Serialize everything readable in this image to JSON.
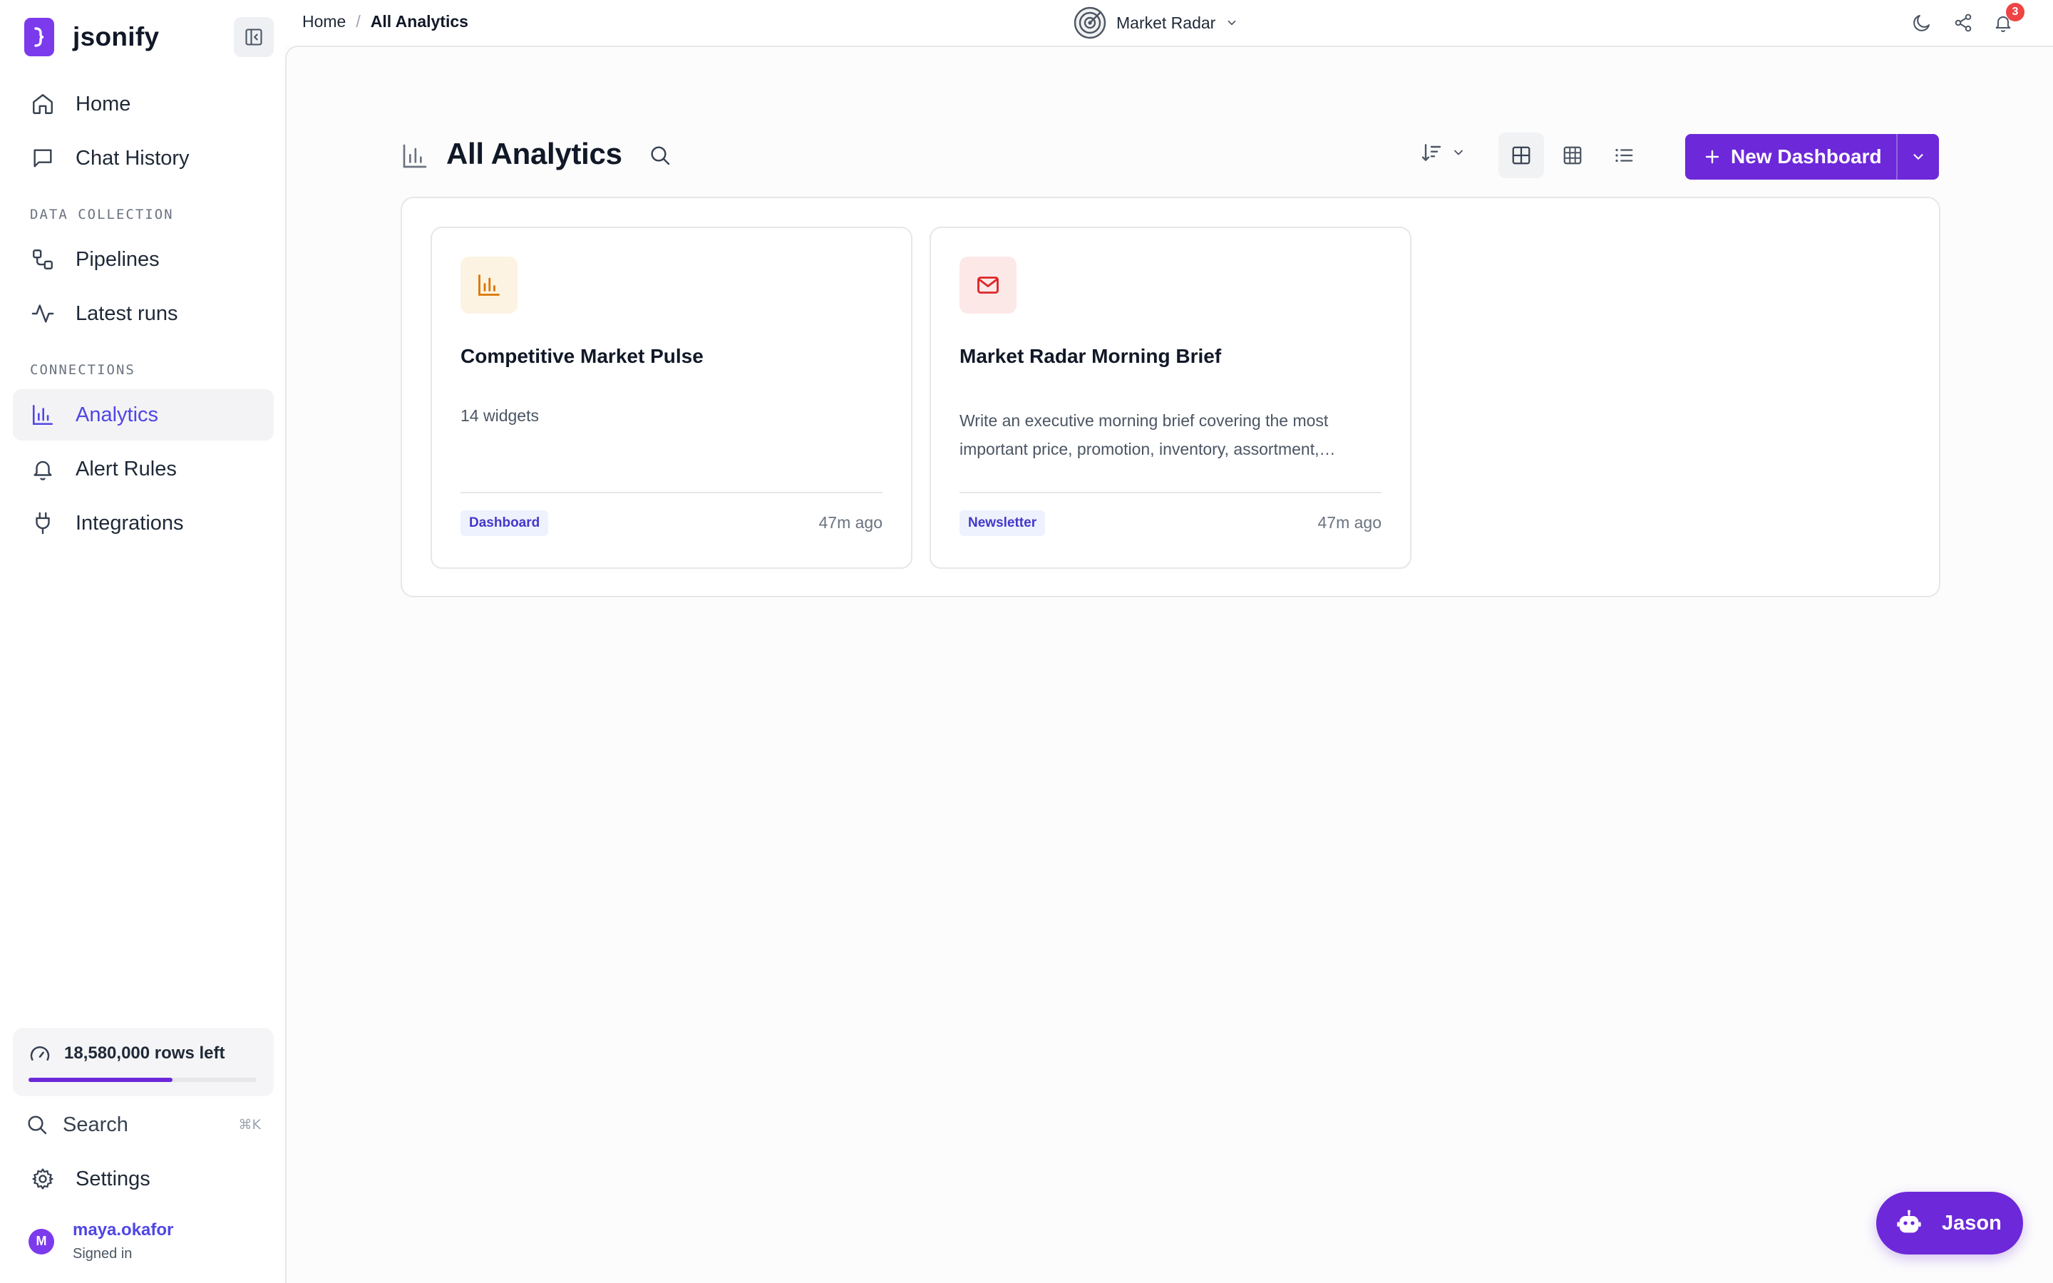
{
  "app": {
    "name": "jsonify"
  },
  "sidebar": {
    "nav": [
      {
        "label": "Home",
        "icon": "home-icon"
      },
      {
        "label": "Chat History",
        "icon": "chat-icon"
      }
    ],
    "section_data_collection": "DATA COLLECTION",
    "data_collection": [
      {
        "label": "Pipelines",
        "icon": "pipeline-icon"
      },
      {
        "label": "Latest runs",
        "icon": "activity-icon"
      }
    ],
    "section_connections": "CONNECTIONS",
    "connections": [
      {
        "label": "Analytics",
        "icon": "bar-chart-icon",
        "active": true
      },
      {
        "label": "Alert Rules",
        "icon": "bell-icon"
      },
      {
        "label": "Integrations",
        "icon": "plug-icon"
      }
    ],
    "usage": {
      "text": "18,580,000 rows left",
      "fraction": 0.63
    },
    "search": {
      "label": "Search",
      "shortcut": "⌘K"
    },
    "settings": {
      "label": "Settings"
    },
    "user": {
      "initial": "M",
      "name": "maya.okafor",
      "status": "Signed in"
    }
  },
  "topbar": {
    "breadcrumb": {
      "home": "Home",
      "separator": "/",
      "current": "All Analytics"
    },
    "workspace": {
      "name": "Market Radar",
      "icon": "radar-icon"
    },
    "notifications_count": "3"
  },
  "page": {
    "title": "All Analytics",
    "new_button": {
      "label": "New Dashboard"
    },
    "cards": [
      {
        "title": "Competitive Market Pulse",
        "meta": "14 widgets",
        "tag": "Dashboard",
        "time": "47m ago",
        "icon": "bar-chart-icon",
        "icon_bg": "#fdf3e3",
        "icon_color": "#d97706"
      },
      {
        "title": "Market Radar Morning Brief",
        "description": "Write an executive morning brief covering the most important price, promotion, inventory, assortment,…",
        "tag": "Newsletter",
        "time": "47m ago",
        "icon": "mail-icon",
        "icon_bg": "#fde8e8",
        "icon_color": "#dc2626"
      }
    ]
  },
  "assistant": {
    "label": "Jason"
  },
  "colors": {
    "accent": "#6d28d9",
    "active_text": "#4f46e5",
    "badge": "#ef4444"
  }
}
